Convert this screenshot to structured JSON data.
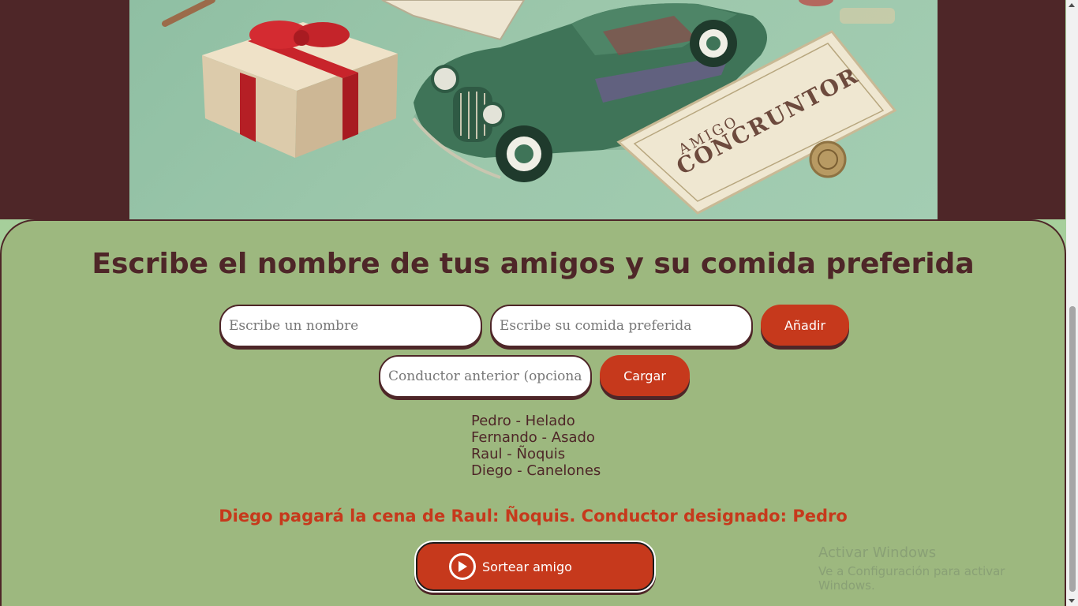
{
  "banner": {
    "ticket_line1": "AMIGO",
    "ticket_line2": "CONCRUNTOR"
  },
  "heading": "Escribe el nombre de tus amigos y su comida preferida",
  "form": {
    "name_placeholder": "Escribe un nombre",
    "food_placeholder": "Escribe su comida preferida",
    "add_label": "Añadir",
    "driver_placeholder": "Conductor anterior (opcional)",
    "load_label": "Cargar"
  },
  "friends": [
    "Pedro - Helado",
    "Fernando - Asado",
    "Raul - Ñoquis",
    "Diego - Canelones"
  ],
  "result": "Diego pagará la cena de Raul: Ñoquis. Conductor designado: Pedro",
  "draw_button": {
    "label": "Sortear amigo",
    "icon": "play-circle-icon"
  },
  "watermark": {
    "line1": "Activar Windows",
    "line2": "Ve a Configuración para activar Windows."
  },
  "colors": {
    "maroon": "#4e2628",
    "accent": "#c6391c",
    "panel": "#9db87f",
    "banner": "#9cc7ab"
  }
}
